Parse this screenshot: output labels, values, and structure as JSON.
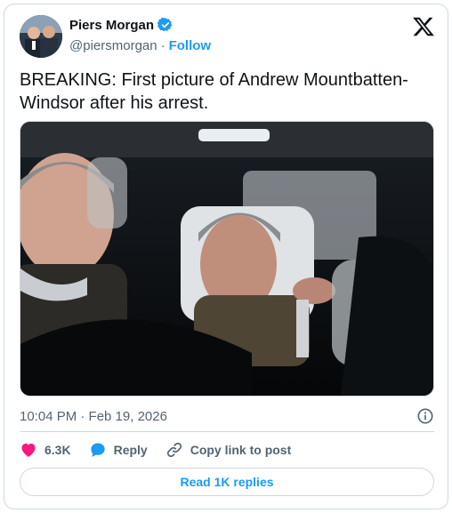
{
  "author": {
    "display_name": "Piers Morgan",
    "handle": "@piersmorgan",
    "separator": "·",
    "follow_label": "Follow",
    "verified": true,
    "avatar_icon": "avatar"
  },
  "platform_icon": "x-logo-icon",
  "tweet": {
    "text": "BREAKING: First picture of Andrew Mountbatten-\nWindsor after his arrest."
  },
  "media": {
    "icon": "photo"
  },
  "meta": {
    "timestamp": "10:04 PM · Feb 19, 2026",
    "info_icon": "info-icon"
  },
  "actions": {
    "like_count": "6.3K",
    "reply_label": "Reply",
    "copy_link_label": "Copy link to post"
  },
  "read_replies_label": "Read 1K replies",
  "colors": {
    "accent": "#1d9bf0",
    "like": "#f91880",
    "text": "#0f1419",
    "muted": "#536471",
    "border": "#cfd9de"
  }
}
